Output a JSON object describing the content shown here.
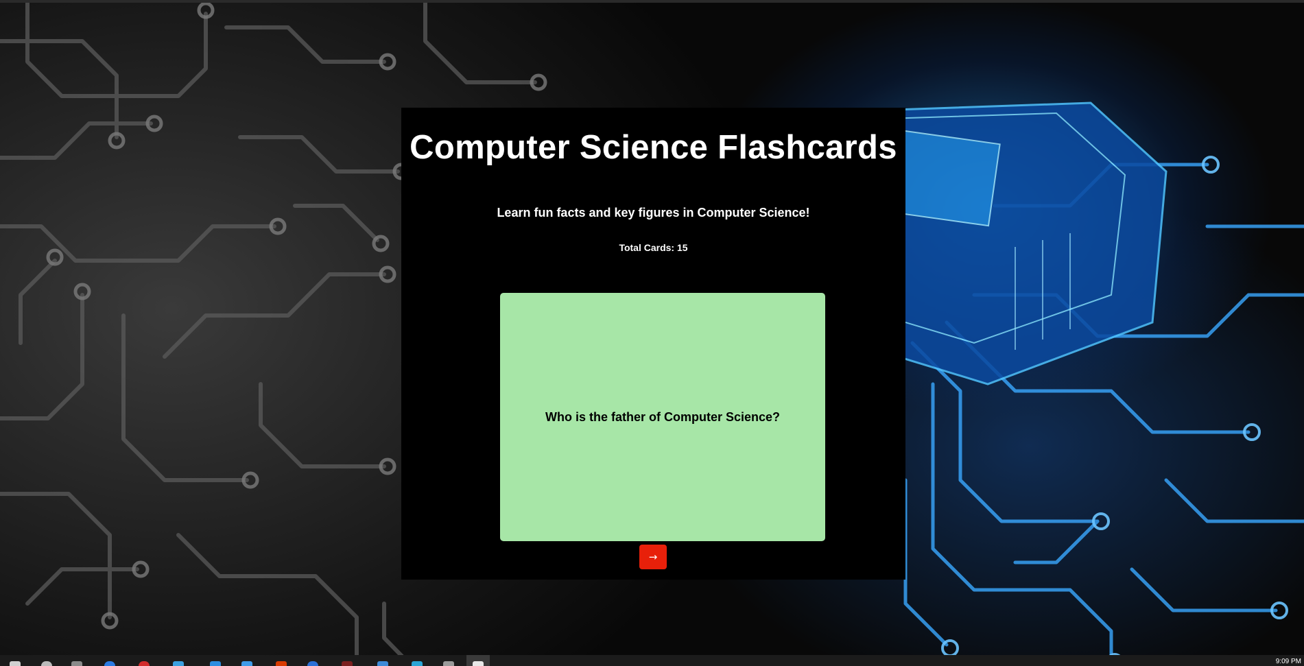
{
  "app": {
    "title": "Computer Science Flashcards",
    "subtitle": "Learn fun facts and key figures in Computer Science!",
    "card_count": "Total Cards: 15"
  },
  "flashcard": {
    "text": "Who is the father of Computer Science?",
    "color": "#a7e6a7"
  },
  "controls": {
    "next_label": "→",
    "next_color": "#e8200a"
  },
  "taskbar": {
    "clock": "9:09 PM",
    "icons": [
      "windows-icon",
      "search-icon",
      "task-view-icon",
      "chrome-icon",
      "opera-icon",
      "store-icon",
      "edge-icon",
      "folder-icon",
      "office-icon",
      "browser-icon",
      "game-icon",
      "app-icon",
      "app-icon",
      "app-icon",
      "app-icon"
    ]
  }
}
